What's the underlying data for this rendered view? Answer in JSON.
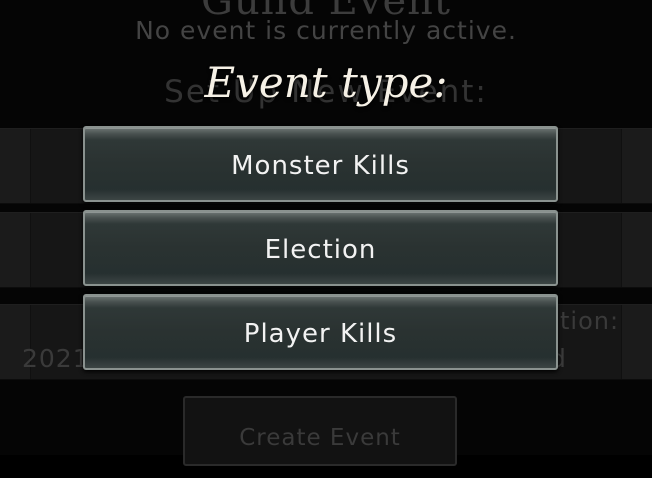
{
  "background": {
    "title": "Guild Event",
    "status": "No event is currently active.",
    "section_label": "Set Up New Event:",
    "date_fragment": "2021",
    "duration_label": "tion:",
    "duration_value": "d",
    "create_button_label": "Create Event"
  },
  "modal": {
    "title": "Event type:",
    "options": [
      {
        "label": "Monster Kills"
      },
      {
        "label": "Election"
      },
      {
        "label": "Player Kills"
      }
    ]
  }
}
